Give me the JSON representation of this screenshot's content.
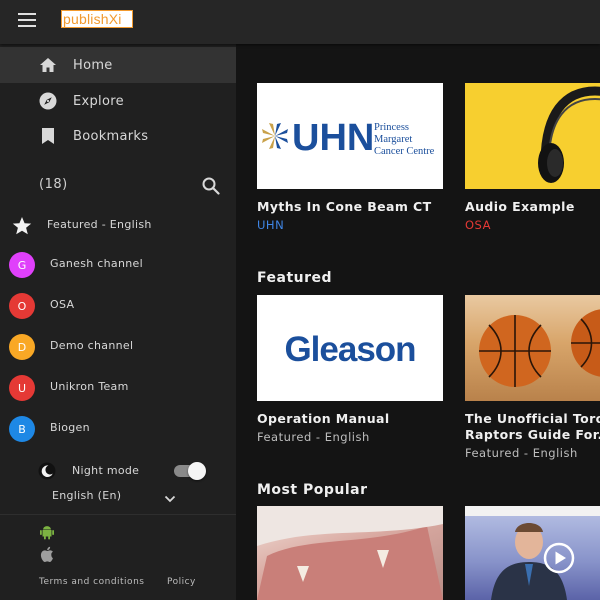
{
  "app": {
    "logo_text": "publishXi"
  },
  "sidebar": {
    "nav": [
      {
        "label": "Home",
        "icon": "home-icon",
        "active": true
      },
      {
        "label": "Explore",
        "icon": "compass-icon",
        "active": false
      },
      {
        "label": "Bookmarks",
        "icon": "bookmark-icon",
        "active": false
      }
    ],
    "count_label": "(18)",
    "channels": [
      {
        "label": "Featured - English",
        "badge": "",
        "icon": "star-icon"
      },
      {
        "label": "Ganesh channel",
        "badge": "G",
        "color": "#e040fb"
      },
      {
        "label": "OSA",
        "badge": "O",
        "color": "#e53935"
      },
      {
        "label": "Demo channel",
        "badge": "D",
        "color": "#f9a825"
      },
      {
        "label": "Unikron Team",
        "badge": "U",
        "color": "#e53935"
      },
      {
        "label": "Biogen",
        "badge": "B",
        "color": "#1e88e5"
      }
    ],
    "night_mode": {
      "label": "Night mode",
      "enabled": true
    },
    "language": {
      "selected": "English (En)"
    },
    "footer": {
      "terms": "Terms and conditions",
      "policy": "Policy"
    }
  },
  "main": {
    "top_cards": [
      {
        "title": "Myths In Cone Beam CT",
        "channel": "UHN",
        "channel_color": "#3f86e6",
        "logo": {
          "wordmark": "UHN",
          "lines": [
            "Princess",
            "Margaret",
            "Cancer Centre"
          ]
        }
      },
      {
        "title": "Audio Example",
        "channel": "OSA",
        "channel_color": "#e53935"
      }
    ],
    "featured": {
      "heading": "Featured",
      "cards": [
        {
          "title": "Operation Manual",
          "subtitle": "Featured - English",
          "logo_text": "Gleason"
        },
        {
          "title": "The Unofficial Toronto",
          "title_line2": "Raptors Guide For...",
          "subtitle": "Featured - English"
        }
      ]
    },
    "most_popular": {
      "heading": "Most Popular"
    }
  },
  "colors": {
    "topbar": "#262626",
    "sidebar": "#202020",
    "active_nav": "#333333",
    "main_bg": "#141414"
  }
}
